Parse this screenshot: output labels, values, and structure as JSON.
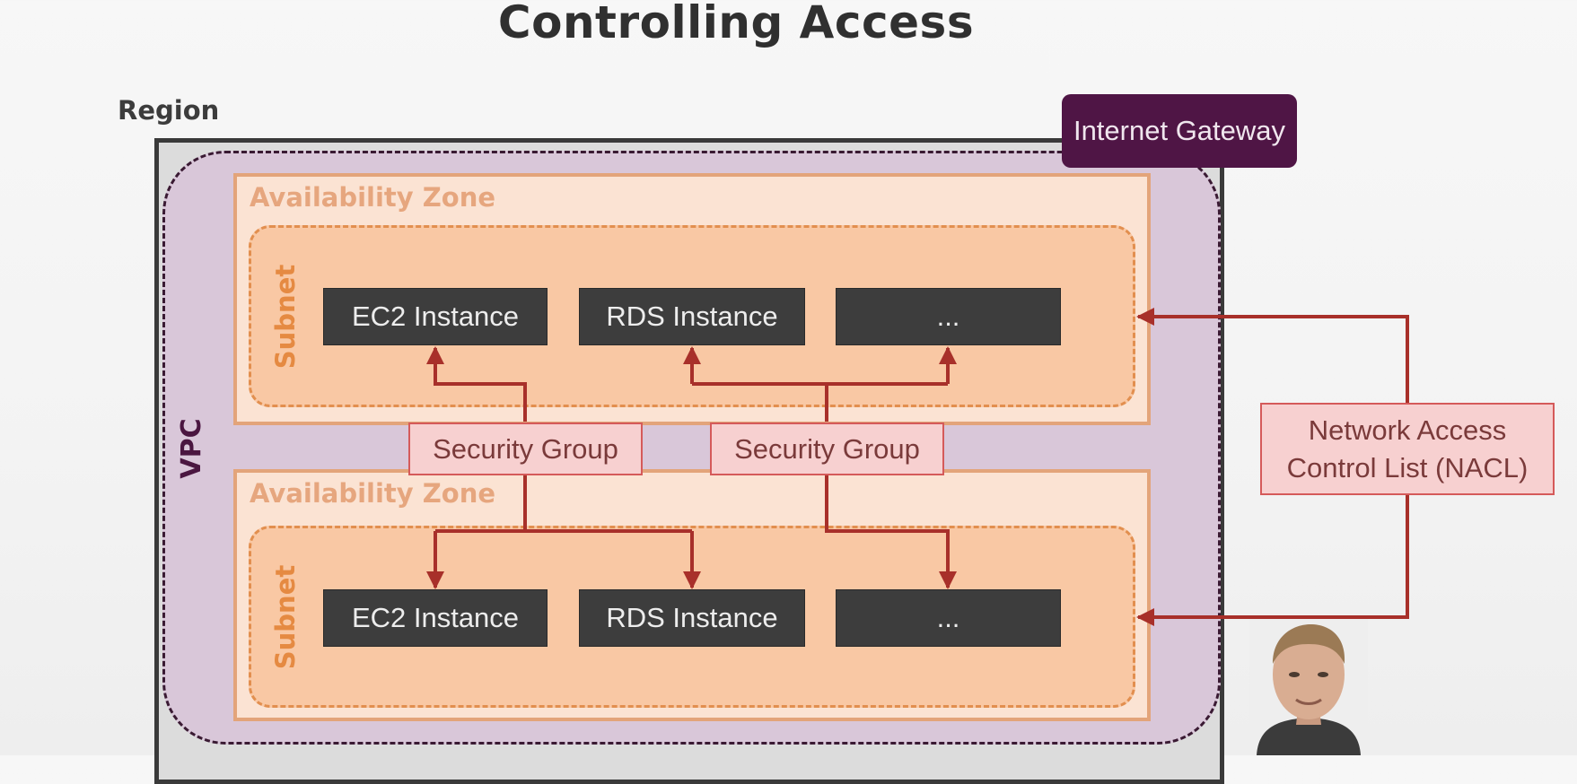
{
  "title": "Controlling Access",
  "region": {
    "label": "Region"
  },
  "vpc": {
    "label": "VPC"
  },
  "internet_gateway": {
    "label": "Internet Gateway"
  },
  "availability_zones": [
    {
      "label": "Availability Zone",
      "subnet": {
        "label": "Subnet",
        "instances": [
          "EC2 Instance",
          "RDS Instance",
          "..."
        ]
      }
    },
    {
      "label": "Availability Zone",
      "subnet": {
        "label": "Subnet",
        "instances": [
          "EC2 Instance",
          "RDS Instance",
          "..."
        ]
      }
    }
  ],
  "security_groups": [
    {
      "label": "Security Group"
    },
    {
      "label": "Security Group"
    }
  ],
  "nacl": {
    "label": "Network Access Control List (NACL)"
  },
  "colors": {
    "arrow": "#a8302a",
    "internet_gateway": "#4f1545",
    "az_border": "#e3a47a",
    "subnet_fill": "#f9c8a4",
    "instance_fill": "#3d3d3d",
    "pink_box_fill": "#f7d0d0"
  }
}
